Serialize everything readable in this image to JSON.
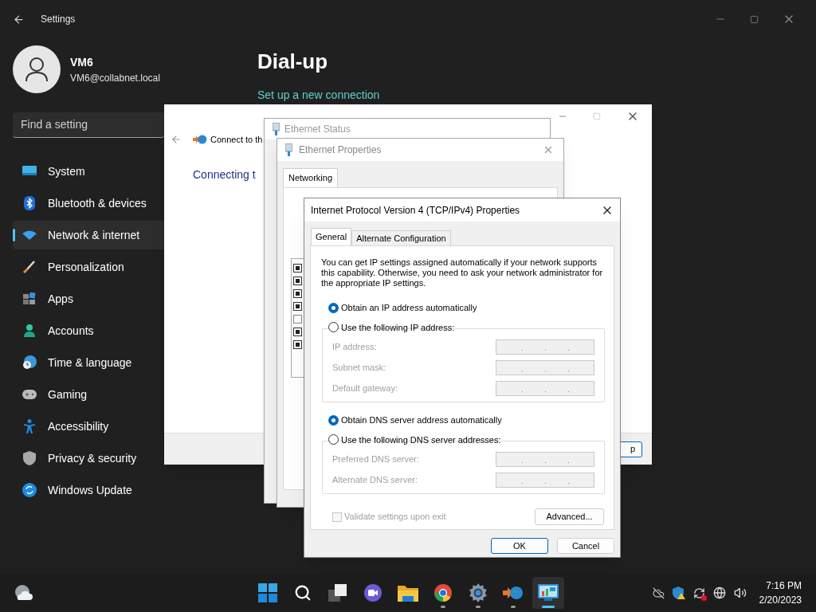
{
  "settings": {
    "title": "Settings",
    "user": {
      "name": "VM6",
      "email": "VM6@collabnet.local"
    },
    "search": {
      "placeholder": "Find a setting"
    },
    "nav": [
      {
        "kind": "system",
        "label": "System",
        "selected": false
      },
      {
        "kind": "bluetooth",
        "label": "Bluetooth & devices",
        "selected": false
      },
      {
        "kind": "network",
        "label": "Network & internet",
        "selected": true
      },
      {
        "kind": "personalization",
        "label": "Personalization",
        "selected": false
      },
      {
        "kind": "apps",
        "label": "Apps",
        "selected": false
      },
      {
        "kind": "accounts",
        "label": "Accounts",
        "selected": false
      },
      {
        "kind": "time",
        "label": "Time & language",
        "selected": false
      },
      {
        "kind": "gaming",
        "label": "Gaming",
        "selected": false
      },
      {
        "kind": "accessibility",
        "label": "Accessibility",
        "selected": false
      },
      {
        "kind": "privacy",
        "label": "Privacy & security",
        "selected": false
      },
      {
        "kind": "update",
        "label": "Windows Update",
        "selected": false
      }
    ],
    "page_title": "Dial-up",
    "link": "Set up a new connection"
  },
  "wizard": {
    "title": "Connect to th",
    "heading": "Connecting t",
    "button": "p"
  },
  "ethernet_status": {
    "title": "Ethernet Status"
  },
  "ethernet_properties": {
    "title": "Ethernet Properties",
    "tab": "Networking",
    "components": [
      {
        "checked": true
      },
      {
        "checked": true
      },
      {
        "checked": true
      },
      {
        "checked": true
      },
      {
        "checked": false
      },
      {
        "checked": true
      },
      {
        "checked": true
      }
    ]
  },
  "ipv4": {
    "title": "Internet Protocol Version 4 (TCP/IPv4) Properties",
    "tabs": [
      {
        "label": "General",
        "selected": true
      },
      {
        "label": "Alternate Configuration",
        "selected": false
      }
    ],
    "description": "You can get IP settings assigned automatically if your network supports this capability. Otherwise, you need to ask your network administrator for the appropriate IP settings.",
    "ip_mode": [
      {
        "label": "Obtain an IP address automatically",
        "selected": true
      },
      {
        "label": "Use the following IP address:",
        "selected": false
      }
    ],
    "ip_fields": [
      {
        "label": "IP address:",
        "disabled": true
      },
      {
        "label": "Subnet mask:",
        "disabled": true
      },
      {
        "label": "Default gateway:",
        "disabled": true
      }
    ],
    "dns_mode": [
      {
        "label": "Obtain DNS server address automatically",
        "selected": true
      },
      {
        "label": "Use the following DNS server addresses:",
        "selected": false
      }
    ],
    "dns_fields": [
      {
        "label": "Preferred DNS server:",
        "disabled": true
      },
      {
        "label": "Alternate DNS server:",
        "disabled": true
      }
    ],
    "validate": {
      "label": "Validate settings upon exit",
      "checked": false,
      "disabled": true
    },
    "advanced": "Advanced...",
    "buttons": [
      {
        "label": "OK",
        "default": true
      },
      {
        "label": "Cancel",
        "default": false
      }
    ]
  },
  "taskbar": {
    "apps": [
      {
        "kind": "start",
        "running": false,
        "selected": false
      },
      {
        "kind": "search",
        "running": false,
        "selected": false
      },
      {
        "kind": "taskview",
        "running": false,
        "selected": false
      },
      {
        "kind": "chat",
        "running": false,
        "selected": false
      },
      {
        "kind": "explorer",
        "running": false,
        "selected": false
      },
      {
        "kind": "chrome",
        "running": true,
        "selected": false
      },
      {
        "kind": "settings",
        "running": true,
        "selected": false
      },
      {
        "kind": "connect",
        "running": true,
        "selected": false
      },
      {
        "kind": "controlpanel",
        "running": true,
        "selected": true
      }
    ],
    "time": "7:16 PM",
    "date": "2/20/2023"
  }
}
